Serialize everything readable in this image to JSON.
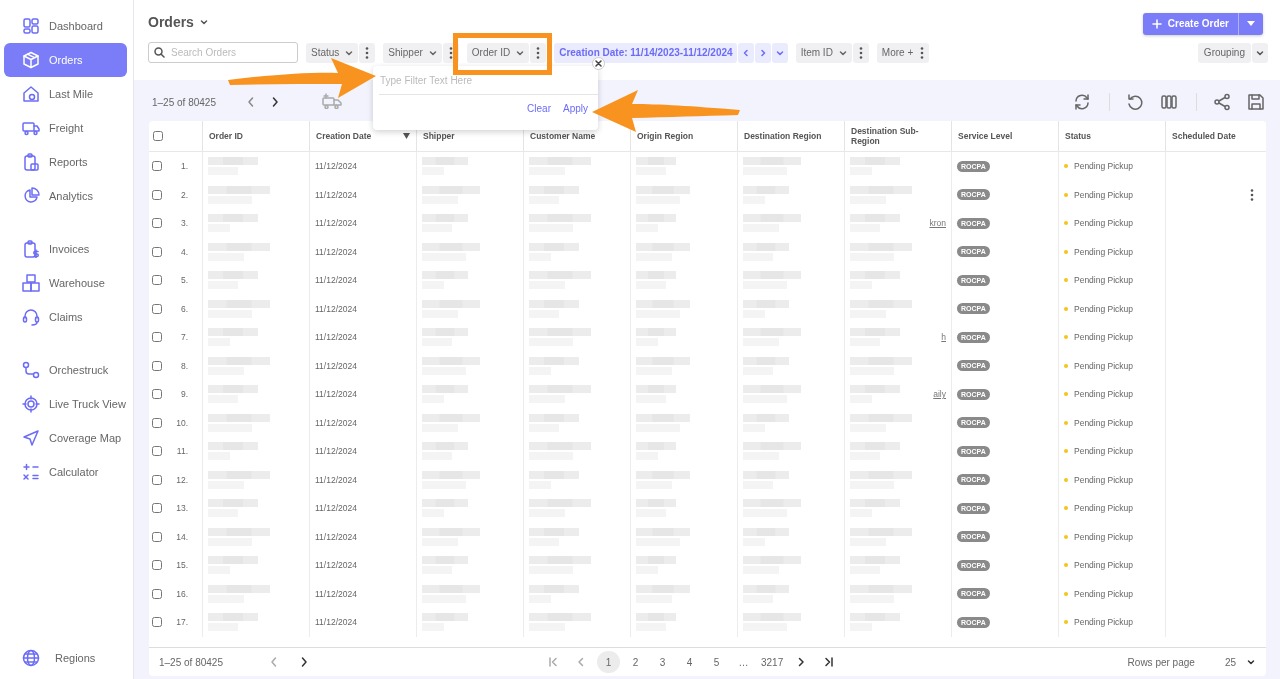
{
  "sidebar": {
    "groups": [
      [
        {
          "label": "Dashboard",
          "selected": false
        },
        {
          "label": "Orders",
          "selected": true
        },
        {
          "label": "Last Mile",
          "selected": false
        },
        {
          "label": "Freight",
          "selected": false
        },
        {
          "label": "Reports",
          "selected": false
        },
        {
          "label": "Analytics",
          "selected": false
        }
      ],
      [
        {
          "label": "Invoices",
          "selected": false
        },
        {
          "label": "Warehouse",
          "selected": false
        },
        {
          "label": "Claims",
          "selected": false
        }
      ],
      [
        {
          "label": "Orchestruck",
          "selected": false
        },
        {
          "label": "Live Truck View",
          "selected": false
        },
        {
          "label": "Coverage Map",
          "selected": false
        },
        {
          "label": "Calculator",
          "selected": false
        }
      ]
    ],
    "footer_item": {
      "label": "Regions",
      "selected": false
    }
  },
  "header": {
    "title": "Orders",
    "create_button": "Create Order"
  },
  "filters": {
    "search_placeholder": "Search Orders",
    "chips": [
      {
        "kind": "dropdown",
        "label": "Status",
        "active": false
      },
      {
        "kind": "dropdown",
        "label": "Shipper",
        "active": false
      },
      {
        "kind": "dropdown",
        "label": "Order ID",
        "active": false
      },
      {
        "kind": "range",
        "label": "Creation Date: 11/14/2023-11/12/2024",
        "active": true
      },
      {
        "kind": "dropdown",
        "label": "Item ID",
        "active": false
      },
      {
        "kind": "more",
        "label": "More +",
        "active": false
      }
    ],
    "grouping": "Grouping"
  },
  "filter_popup": {
    "placeholder": "Type Filter Text Here",
    "buttons": [
      "Clear",
      "Apply"
    ]
  },
  "toolbar": {
    "range": "1–25 of 80425"
  },
  "table": {
    "select_all_checked": false,
    "columns": [
      {
        "label": "Order ID",
        "kind": "blurred",
        "sorted": false
      },
      {
        "label": "Creation Date",
        "kind": "date",
        "sorted": true
      },
      {
        "label": "Shipper",
        "kind": "blurred",
        "sorted": false
      },
      {
        "label": "Customer Name",
        "kind": "blurred",
        "sorted": false
      },
      {
        "label": "Origin Region",
        "kind": "blurred",
        "sorted": false
      },
      {
        "label": "Destination Region",
        "kind": "blurred",
        "sorted": false
      },
      {
        "label": "Destination Sub-Region",
        "kind": "blurred",
        "sorted": false
      },
      {
        "label": "Service Level",
        "kind": "tag",
        "sorted": false
      },
      {
        "label": "Status",
        "kind": "status",
        "sorted": false
      },
      {
        "label": "Scheduled Date",
        "kind": "actions",
        "sorted": false
      }
    ],
    "rows": [
      {
        "number": "1.",
        "creation_date": "11/12/2024",
        "service_level": "ROCPA",
        "status": "Pending Pickup",
        "color": "#f5c518",
        "checked": false,
        "hovered": false
      },
      {
        "number": "2.",
        "creation_date": "11/12/2024",
        "service_level": "ROCPA",
        "status": "Pending Pickup",
        "color": "#f5c518",
        "checked": false,
        "hovered": true
      },
      {
        "number": "3.",
        "creation_date": "11/12/2024",
        "service_level": "ROCPA",
        "status": "Pending Pickup",
        "color": "#f5c518",
        "checked": false,
        "hovered": false,
        "sub_region_tail": "kron"
      },
      {
        "number": "4.",
        "creation_date": "11/12/2024",
        "service_level": "ROCPA",
        "status": "Pending Pickup",
        "color": "#f5c518",
        "checked": false,
        "hovered": false
      },
      {
        "number": "5.",
        "creation_date": "11/12/2024",
        "service_level": "ROCPA",
        "status": "Pending Pickup",
        "color": "#f5c518",
        "checked": false,
        "hovered": false
      },
      {
        "number": "6.",
        "creation_date": "11/12/2024",
        "service_level": "ROCPA",
        "status": "Pending Pickup",
        "color": "#f5c518",
        "checked": false,
        "hovered": false
      },
      {
        "number": "7.",
        "creation_date": "11/12/2024",
        "service_level": "ROCPA",
        "status": "Pending Pickup",
        "color": "#f5c518",
        "checked": false,
        "hovered": false,
        "sub_region_tail": "h"
      },
      {
        "number": "8.",
        "creation_date": "11/12/2024",
        "service_level": "ROCPA",
        "status": "Pending Pickup",
        "color": "#f5c518",
        "checked": false,
        "hovered": false
      },
      {
        "number": "9.",
        "creation_date": "11/12/2024",
        "service_level": "ROCPA",
        "status": "Pending Pickup",
        "color": "#f5c518",
        "checked": false,
        "hovered": false,
        "sub_region_tail": "aily"
      },
      {
        "number": "10.",
        "creation_date": "11/12/2024",
        "service_level": "ROCPA",
        "status": "Pending Pickup",
        "color": "#f5c518",
        "checked": false,
        "hovered": false
      },
      {
        "number": "11.",
        "creation_date": "11/12/2024",
        "service_level": "ROCPA",
        "status": "Pending Pickup",
        "color": "#f5c518",
        "checked": false,
        "hovered": false
      },
      {
        "number": "12.",
        "creation_date": "11/12/2024",
        "service_level": "ROCPA",
        "status": "Pending Pickup",
        "color": "#f5c518",
        "checked": false,
        "hovered": false
      },
      {
        "number": "13.",
        "creation_date": "11/12/2024",
        "service_level": "ROCPA",
        "status": "Pending Pickup",
        "color": "#f5c518",
        "checked": false,
        "hovered": false
      },
      {
        "number": "14.",
        "creation_date": "11/12/2024",
        "service_level": "ROCPA",
        "status": "Pending Pickup",
        "color": "#f5c518",
        "checked": false,
        "hovered": false
      },
      {
        "number": "15.",
        "creation_date": "11/12/2024",
        "service_level": "ROCPA",
        "status": "Pending Pickup",
        "color": "#f5c518",
        "checked": false,
        "hovered": false
      },
      {
        "number": "16.",
        "creation_date": "11/12/2024",
        "service_level": "ROCPA",
        "status": "Pending Pickup",
        "color": "#f5c518",
        "checked": false,
        "hovered": false
      },
      {
        "number": "17.",
        "creation_date": "11/12/2024",
        "service_level": "ROCPA",
        "status": "Pending Pickup",
        "color": "#f5c518",
        "checked": false,
        "hovered": false
      }
    ]
  },
  "pagination": {
    "range": "1–25 of 80425",
    "pages": [
      {
        "label": "1",
        "selected": true
      },
      {
        "label": "2",
        "selected": false
      },
      {
        "label": "3",
        "selected": false
      },
      {
        "label": "4",
        "selected": false
      },
      {
        "label": "5",
        "selected": false
      },
      {
        "label": "…",
        "selected": false
      },
      {
        "label": "3217",
        "selected": false
      }
    ],
    "rows_per_page_label": "Rows per page",
    "rows_per_page": "25"
  },
  "callouts": [
    {
      "kind": "highlight"
    },
    {
      "kind": "arrow"
    },
    {
      "kind": "arrow"
    }
  ]
}
